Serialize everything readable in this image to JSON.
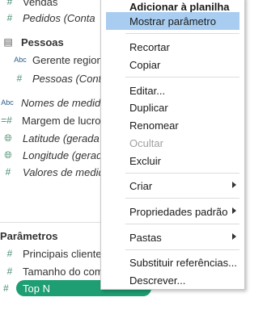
{
  "data_pane": {
    "fields": [
      {
        "icon": "#",
        "label": "Vendas",
        "italic": false
      },
      {
        "icon": "#",
        "label": "Pedidos (Conta",
        "italic": true
      }
    ],
    "table_name": "Pessoas",
    "table_fields": [
      {
        "icon": "Abc",
        "label": "Gerente regiona",
        "italic": false
      },
      {
        "icon": "#",
        "label": "Pessoas (Conta",
        "italic": true
      }
    ],
    "other_fields": [
      {
        "icon": "Abc",
        "label": "Nomes de medida",
        "italic": true
      },
      {
        "icon": "=#",
        "label": "Margem de lucro",
        "italic": false
      },
      {
        "icon": "globe",
        "label": "Latitude (gerada",
        "italic": true
      },
      {
        "icon": "globe",
        "label": "Longitude (gerada",
        "italic": true
      },
      {
        "icon": "#",
        "label": "Valores de medida",
        "italic": true
      }
    ]
  },
  "parameters": {
    "title": "Parâmetros",
    "items": [
      {
        "icon": "#",
        "label": "Principais clientes"
      },
      {
        "icon": "#",
        "label": "Tamanho do com"
      },
      {
        "icon": "#",
        "label": "Top N",
        "selected": true
      }
    ]
  },
  "context_menu": {
    "items": [
      {
        "label": "Adicionar à planilha",
        "bold": true
      },
      {
        "label": "Mostrar parâmetro",
        "highlighted": true
      },
      {
        "label": "Recortar"
      },
      {
        "label": "Copiar"
      },
      {
        "label": "Editar..."
      },
      {
        "label": "Duplicar"
      },
      {
        "label": "Renomear"
      },
      {
        "label": "Ocultar",
        "disabled": true
      },
      {
        "label": "Excluir"
      },
      {
        "label": "Criar",
        "submenu": true
      },
      {
        "label": "Propriedades padrão",
        "submenu": true
      },
      {
        "label": "Pastas",
        "submenu": true
      },
      {
        "label": "Substituir referências..."
      },
      {
        "label": "Descrever..."
      }
    ]
  },
  "colors": {
    "selected_pill": "#1e9e72",
    "menu_highlight": "#a8cdf0",
    "measure_icon": "#4a8c6f",
    "dimension_icon": "#2b5d8a"
  }
}
